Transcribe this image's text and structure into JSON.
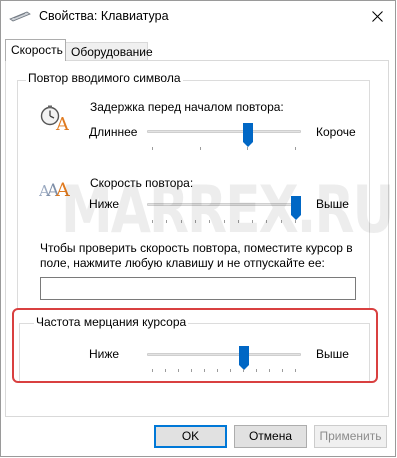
{
  "window": {
    "title": "Свойства: Клавиатура",
    "icon": "keyboard-icon",
    "close_icon": "close-icon"
  },
  "tabs": [
    {
      "label": "Скорость",
      "active": true
    },
    {
      "label": "Оборудование",
      "active": false
    }
  ],
  "repeat_group": {
    "legend": "Повтор вводимого символа",
    "delay": {
      "label": "Задержка перед началом повтора:",
      "left_label": "Длиннее",
      "right_label": "Короче",
      "value_fraction": 0.667,
      "icon": "stopwatch-letter-a-icon"
    },
    "rate": {
      "label": "Скорость повтора:",
      "left_label": "Ниже",
      "right_label": "Выше",
      "value_fraction": 1.0,
      "icon": "repeating-letters-icon"
    },
    "test_hint": "Чтобы проверить скорость повтора, поместите курсор в поле, нажмите любую клавишу и не отпускайте ее:",
    "test_value": ""
  },
  "cursor_group": {
    "legend": "Частота мерцания курсора",
    "left_label": "Ниже",
    "right_label": "Выше",
    "value_fraction": 0.636
  },
  "buttons": {
    "ok": "OK",
    "cancel": "Отмена",
    "apply": "Применить"
  },
  "watermark": "MARREX.RU",
  "colors": {
    "accent": "#0067c5",
    "highlight": "#d94040"
  }
}
